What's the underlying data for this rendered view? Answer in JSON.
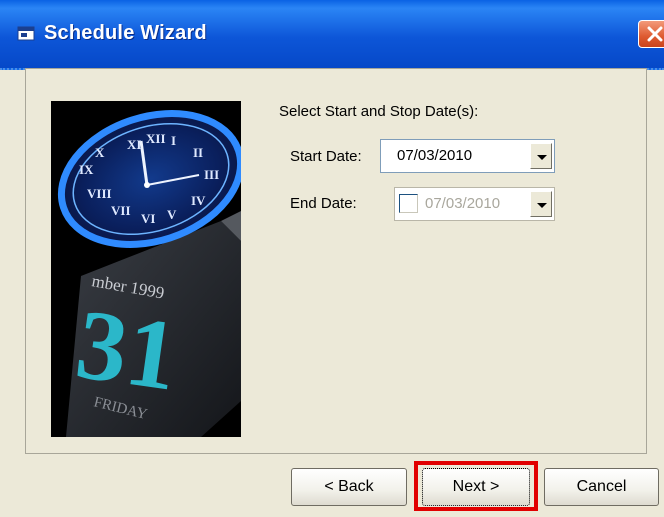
{
  "window": {
    "title": "Schedule Wizard",
    "icon": "window-app-icon",
    "close_icon": "close-icon"
  },
  "illustration": {
    "icon": "clock-calendar-image",
    "calendar_month": "mber 1999",
    "calendar_day": "31",
    "calendar_weekday": "FRIDAY"
  },
  "form": {
    "heading": "Select Start and Stop Date(s):",
    "start_label": "Start Date:",
    "start_value": "07/03/2010",
    "end_label": "End Date:",
    "end_value": "07/03/2010",
    "end_checked": false
  },
  "buttons": {
    "back": "< Back",
    "next": "Next >",
    "cancel": "Cancel"
  },
  "colors": {
    "titlebar": "#0a5ad8",
    "dialog_bg": "#ECE9D8",
    "highlight": "#e10000"
  }
}
